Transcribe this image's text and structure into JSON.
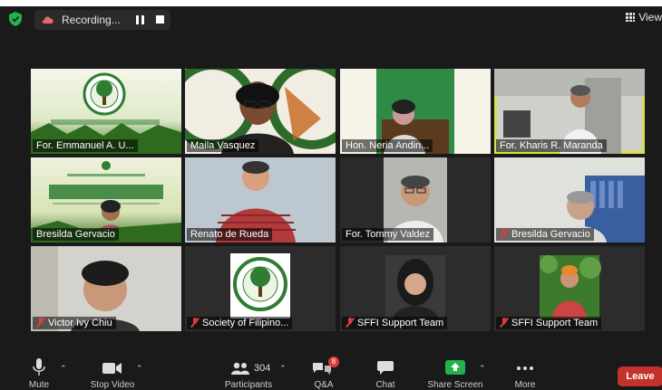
{
  "topbar": {
    "recording_label": "Recording...",
    "view_label": "View"
  },
  "participants": [
    {
      "name": "For. Emmanuel A. U...",
      "muted": false
    },
    {
      "name": "Maila Vasquez",
      "muted": false
    },
    {
      "name": "Hon. Neria Andin...",
      "muted": false
    },
    {
      "name": "For. Kharis R. Maranda",
      "muted": false,
      "active_speaker": true
    },
    {
      "name": "Bresilda Gervacio",
      "muted": false
    },
    {
      "name": "Renato de Rueda",
      "muted": false
    },
    {
      "name": "For. Tommy Valdez",
      "muted": false
    },
    {
      "name": "Bresilda Gervacio",
      "muted": true
    },
    {
      "name": "Victor Ivy Chiu",
      "muted": true
    },
    {
      "name": "Society of Filipino...",
      "muted": true
    },
    {
      "name": "SFFI Support Team",
      "muted": true
    },
    {
      "name": "SFFI Support Team",
      "muted": true
    }
  ],
  "toolbar": {
    "mute_label": "Mute",
    "stop_video_label": "Stop Video",
    "participants_label": "Participants",
    "participants_count": "304",
    "qa_label": "Q&A",
    "qa_badge": "8",
    "chat_label": "Chat",
    "share_label": "Share Screen",
    "more_label": "More",
    "leave_label": "Leave"
  },
  "colors": {
    "active_speaker_border": "#d8e04a",
    "share_green": "#23b14d",
    "leave_red": "#c3322b",
    "badge_red": "#e03b3b"
  }
}
